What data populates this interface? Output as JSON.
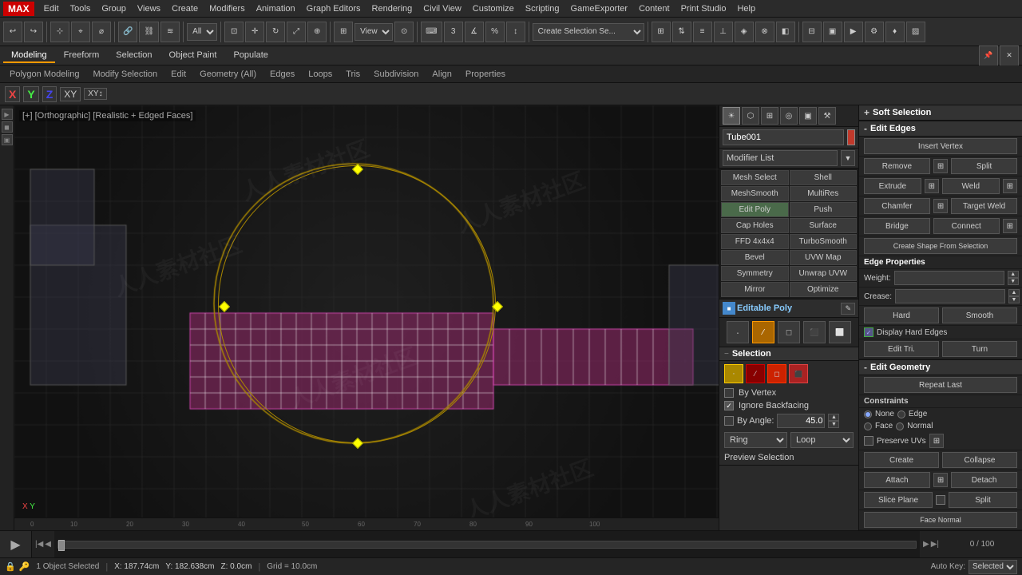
{
  "app": {
    "title": "3ds Max"
  },
  "menu_bar": {
    "items": [
      "MAX",
      "Edit",
      "Tools",
      "Group",
      "Views",
      "Create",
      "Modifiers",
      "Animation",
      "Graph Editors",
      "Rendering",
      "Civil View",
      "Customize",
      "Scripting",
      "GameExporter",
      "Content",
      "Print Studio",
      "Help"
    ]
  },
  "toolbar": {
    "all_label": "All",
    "view_label": "View",
    "create_selection_label": "Create Selection Se..."
  },
  "modeling_tabs": {
    "items": [
      "Modeling",
      "Freeform",
      "Selection",
      "Object Paint",
      "Populate"
    ]
  },
  "edit_bar": {
    "items": [
      "Polygon Modeling",
      "Modify Selection",
      "Edit",
      "Geometry (All)",
      "Edges",
      "Loops",
      "Tris",
      "Subdivision",
      "Align",
      "Properties"
    ]
  },
  "axis_bar": {
    "x": "X",
    "y": "Y",
    "z": "Z",
    "xy": "XY",
    "xyh": "XY↕"
  },
  "viewport": {
    "label": "[+] [Orthographic] [Realistic + Edged Faces]"
  },
  "object_name": "Tube001",
  "modifier_list_label": "Modifier List",
  "modifiers": [
    {
      "label": "Mesh Select",
      "col": 0,
      "row": 0
    },
    {
      "label": "Shell",
      "col": 1,
      "row": 0
    },
    {
      "label": "MeshSmooth",
      "col": 0,
      "row": 1
    },
    {
      "label": "MultiRes",
      "col": 1,
      "row": 1
    },
    {
      "label": "Edit Poly",
      "col": 0,
      "row": 2
    },
    {
      "label": "Push",
      "col": 1,
      "row": 2
    },
    {
      "label": "Cap Holes",
      "col": 0,
      "row": 3
    },
    {
      "label": "Surface",
      "col": 1,
      "row": 3
    },
    {
      "label": "FFD 4x4x4",
      "col": 0,
      "row": 4
    },
    {
      "label": "TurboSmooth",
      "col": 1,
      "row": 4
    },
    {
      "label": "Bevel",
      "col": 0,
      "row": 5
    },
    {
      "label": "UVW Map",
      "col": 1,
      "row": 5
    },
    {
      "label": "Symmetry",
      "col": 0,
      "row": 6
    },
    {
      "label": "Unwrap UVW",
      "col": 1,
      "row": 6
    },
    {
      "label": "Mirror",
      "col": 0,
      "row": 7
    },
    {
      "label": "Optimize",
      "col": 1,
      "row": 7
    }
  ],
  "editable_poly_label": "Editable Poly",
  "properties_panel": {
    "soft_selection": {
      "header_sign": "+",
      "title": "Soft Selection"
    },
    "edit_edges": {
      "header_sign": "-",
      "title": "Edit Edges",
      "insert_vertex": "Insert Vertex",
      "remove": "Remove",
      "split": "Split",
      "extrude": "Extrude",
      "weld": "Weld",
      "chamfer": "Chamfer",
      "target_weld": "Target Weld",
      "bridge": "Bridge",
      "connect": "Connect",
      "create_shape": "Create Shape From Selection",
      "edge_properties": "Edge Properties",
      "weight_label": "Weight:",
      "crease_label": "Crease:",
      "hard": "Hard",
      "smooth": "Smooth",
      "display_hard_edges": "Display Hard Edges",
      "edit_tri": "Edit Tri.",
      "turn": "Turn"
    },
    "edit_geometry": {
      "header_sign": "-",
      "title": "Edit Geometry",
      "repeat_last": "Repeat Last",
      "constraints_label": "Constraints",
      "none": "None",
      "edge": "Edge",
      "face": "Face",
      "normal": "Normal",
      "preserve_uvs": "Preserve UVs",
      "create": "Create",
      "collapse": "Collapse",
      "attach": "Attach",
      "detach": "Detach",
      "slice_plane": "Slice Plane",
      "split": "Split",
      "face_normal": "Face Normal"
    }
  },
  "selection_panel": {
    "header": "Selection",
    "by_vertex_label": "By Vertex",
    "ignore_backfacing_label": "Ignore Backfacing",
    "by_angle_label": "By Angle:",
    "angle_value": "45.0",
    "ring_label": "Ring",
    "loop_label": "Loop",
    "preview_label": "Preview Selection"
  },
  "status_bar": {
    "objects_selected": "1 Object Selected",
    "x_coord": "X: 187.74cm",
    "y_coord": "Y: 182.638cm",
    "z_coord": "Z: 0.0cm",
    "grid": "Grid = 10.0cm",
    "auto_key": "Auto Key:",
    "selected": "Selected"
  },
  "timeline": {
    "frame_display": "0 / 100",
    "play_btn": "▶"
  }
}
